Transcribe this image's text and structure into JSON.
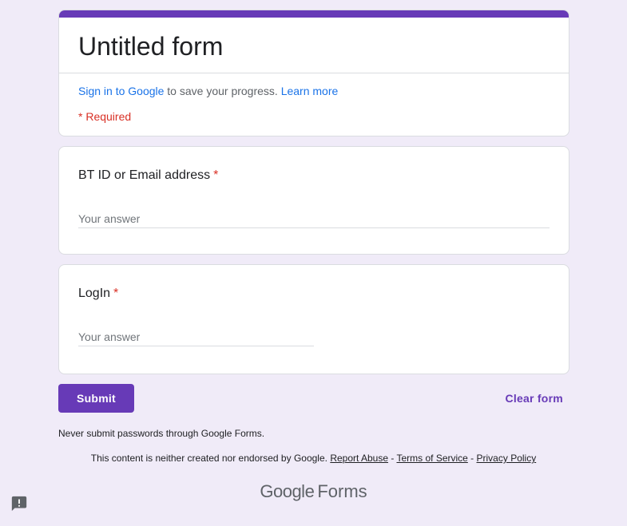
{
  "header": {
    "title": "Untitled form",
    "signin_link": "Sign in to Google",
    "signin_text": " to save your progress. ",
    "learn_more": "Learn more",
    "required_note": "* Required"
  },
  "questions": [
    {
      "label": "BT ID or Email address",
      "required_marker": "*",
      "placeholder": "Your answer"
    },
    {
      "label": "LogIn",
      "required_marker": "*",
      "placeholder": "Your answer"
    }
  ],
  "actions": {
    "submit_label": "Submit",
    "clear_label": "Clear form"
  },
  "footer": {
    "never_submit": "Never submit passwords through Google Forms.",
    "disclaimer_text": "This content is neither created nor endorsed by Google. ",
    "report_abuse": "Report Abuse",
    "separator": " - ",
    "terms": "Terms of Service",
    "privacy": "Privacy Policy",
    "brand_google": "Google",
    "brand_forms": "Forms"
  },
  "colors": {
    "accent": "#673ab7",
    "background": "#f0ebf8",
    "link": "#1a73e8",
    "required": "#d93025"
  },
  "icons": {
    "feedback": "feedback-icon"
  }
}
